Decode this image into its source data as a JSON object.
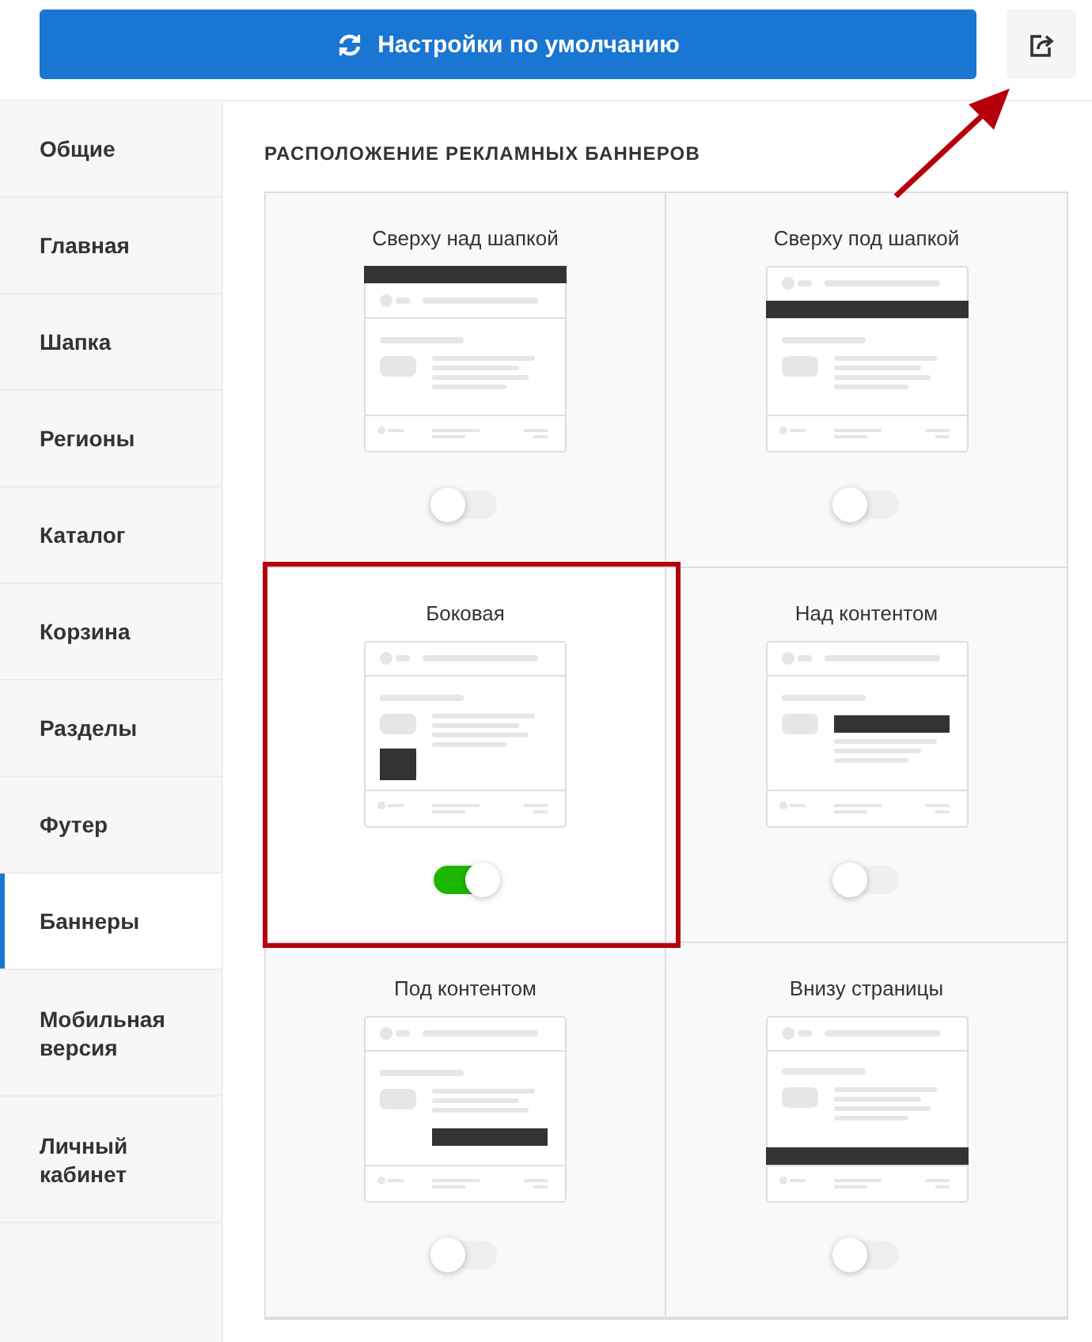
{
  "top_bar": {
    "reset_button": {
      "label": "Настройки по умолчанию"
    },
    "share_button": {
      "annotated": true
    }
  },
  "sidebar": {
    "items": [
      {
        "label": "Общие",
        "selected": false
      },
      {
        "label": "Главная",
        "selected": false
      },
      {
        "label": "Шапка",
        "selected": false
      },
      {
        "label": "Регионы",
        "selected": false
      },
      {
        "label": "Каталог",
        "selected": false
      },
      {
        "label": "Корзина",
        "selected": false
      },
      {
        "label": "Разделы",
        "selected": false
      },
      {
        "label": "Футер",
        "selected": false
      },
      {
        "label": "Баннеры",
        "selected": true
      },
      {
        "label": "Мобильная версия",
        "selected": false
      },
      {
        "label": "Личный кабинет",
        "selected": false
      }
    ]
  },
  "section": {
    "title": "РАСПОЛОЖЕНИЕ РЕКЛАМНЫХ БАННЕРОВ",
    "positions": [
      {
        "title": "Сверху над шапкой",
        "kind": "top-above-header",
        "on": false,
        "highlighted": false
      },
      {
        "title": "Сверху под шапкой",
        "kind": "top-below-header",
        "on": false,
        "highlighted": false
      },
      {
        "title": "Боковая",
        "kind": "side",
        "on": true,
        "highlighted": true
      },
      {
        "title": "Над контентом",
        "kind": "above-content",
        "on": false,
        "highlighted": false
      },
      {
        "title": "Под контентом",
        "kind": "below-content",
        "on": false,
        "highlighted": false
      },
      {
        "title": "Внизу страницы",
        "kind": "page-bottom",
        "on": false,
        "highlighted": false
      }
    ]
  }
}
